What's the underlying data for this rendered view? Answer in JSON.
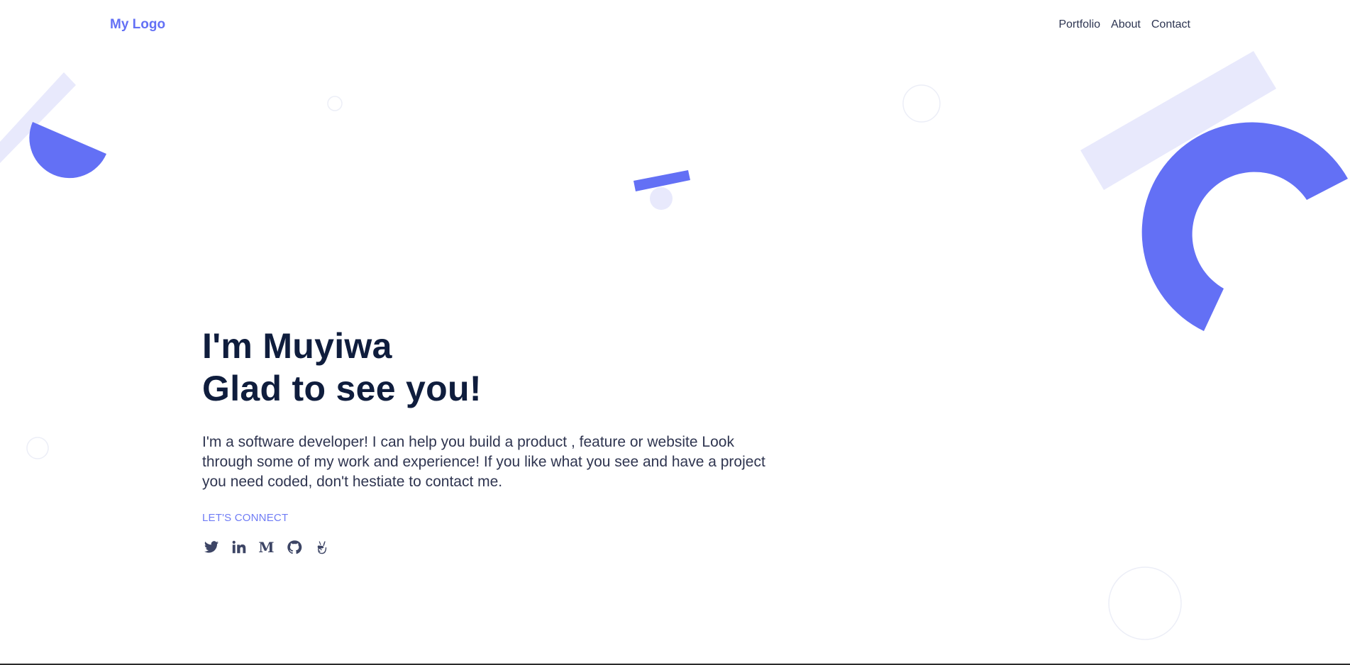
{
  "nav": {
    "logo": "My Logo",
    "links": [
      "Portfolio",
      "About",
      "Contact"
    ]
  },
  "hero": {
    "title_line1": "I'm Muyiwa",
    "title_line2": "Glad to see you!",
    "description": "I'm a software developer! I can help you build a product , feature or website Look through some of my work and experience! If you like what you see and have a project you need coded, don't hestiate to contact me.",
    "connect_label": "LET'S CONNECT"
  },
  "socials": [
    {
      "icon": "twitter-icon"
    },
    {
      "icon": "linkedin-icon"
    },
    {
      "icon": "medium-icon",
      "glyph": "M"
    },
    {
      "icon": "github-icon"
    },
    {
      "icon": "angellist-icon"
    }
  ],
  "colors": {
    "accent": "#6370f5",
    "accent_light": "#e8e9fc",
    "heading": "#0f1d3d",
    "body_text": "#2f3550"
  }
}
